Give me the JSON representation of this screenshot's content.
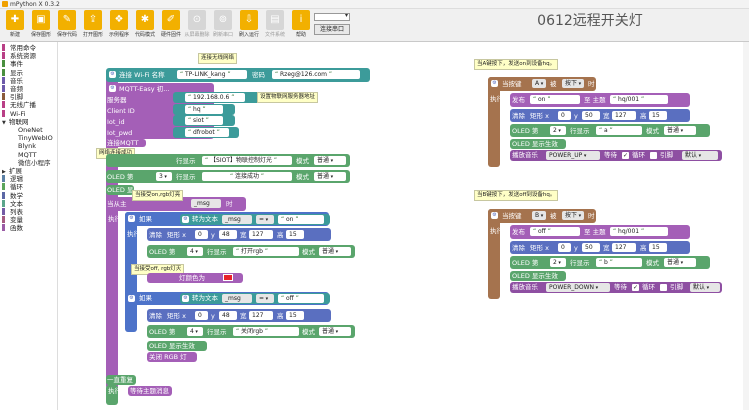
{
  "window": {
    "title": "mPython X 0.3.2"
  },
  "toolbar": {
    "buttons": [
      {
        "label": "新建",
        "icon": "new-file-icon"
      },
      {
        "label": "保存图形",
        "icon": "save-graphic-icon"
      },
      {
        "label": "保存代码",
        "icon": "save-code-icon"
      },
      {
        "label": "打开图形",
        "icon": "open-graphic-icon"
      },
      {
        "label": "示例程序",
        "icon": "example-icon"
      },
      {
        "label": "代码模式",
        "icon": "code-mode-icon"
      },
      {
        "label": "硬件固件",
        "icon": "firmware-icon"
      },
      {
        "label": "从屏幕删除",
        "icon": "disabled-icon"
      },
      {
        "label": "刷新串口",
        "icon": "refresh-icon"
      },
      {
        "label": "刷入运行",
        "icon": "flash-run-icon"
      },
      {
        "label": "文件系统",
        "icon": "file-system-icon"
      },
      {
        "label": "帮助",
        "icon": "help-icon"
      }
    ],
    "port_button": "连接串口"
  },
  "project_title": "0612远程开关灯",
  "sidebar": {
    "items": [
      {
        "label": "常用命令",
        "color": "#b93f86",
        "kind": "hdr"
      },
      {
        "label": "系统资源",
        "color": "#b93f86",
        "kind": "hdr"
      },
      {
        "label": "事件",
        "color": "#4a8f3f",
        "kind": "hdr"
      },
      {
        "label": "显示",
        "color": "#4a8f3f",
        "kind": "hdr"
      },
      {
        "label": "音乐",
        "color": "#6d5aaa",
        "kind": "hdr"
      },
      {
        "label": "音频",
        "color": "#6d5aaa",
        "kind": "hdr"
      },
      {
        "label": "引脚",
        "color": "#8a5a3a",
        "kind": "hdr"
      },
      {
        "label": "无线广播",
        "color": "#b93f86",
        "kind": "hdr"
      },
      {
        "label": "Wi-Fi",
        "color": "#b93f86",
        "kind": "hdr"
      },
      {
        "label": "物联网",
        "color": "",
        "kind": "tri"
      },
      {
        "label": "OneNet",
        "color": "",
        "kind": "sub"
      },
      {
        "label": "TinyWebIO",
        "color": "",
        "kind": "sub"
      },
      {
        "label": "Blynk",
        "color": "",
        "kind": "sub"
      },
      {
        "label": "MQTT",
        "color": "",
        "kind": "sub"
      },
      {
        "label": "微信小程序",
        "color": "",
        "kind": "sub"
      },
      {
        "label": "扩展",
        "color": "",
        "kind": "tri2"
      },
      {
        "label": "逻辑",
        "color": "#5b80a5",
        "kind": "hdr"
      },
      {
        "label": "循环",
        "color": "#5ba55b",
        "kind": "hdr"
      },
      {
        "label": "数学",
        "color": "#5b67a5",
        "kind": "hdr"
      },
      {
        "label": "文本",
        "color": "#5ba58c",
        "kind": "hdr"
      },
      {
        "label": "列表",
        "color": "#745ba5",
        "kind": "hdr"
      },
      {
        "label": "变量",
        "color": "#a55b80",
        "kind": "hdr"
      },
      {
        "label": "函数",
        "color": "#9a5ba5",
        "kind": "hdr"
      }
    ]
  },
  "blocks": {
    "wifi": {
      "label": "连接 Wi-Fi 名称",
      "ssid": "TP-LINK_kang",
      "pwd_label": "密码",
      "pwd": "Rzeg@126.com"
    },
    "mqtt": {
      "title": "MQTT-Easy 初...",
      "server_label": "服务器",
      "server": "192.168.0.6",
      "client_label": "Client ID",
      "client": "hq",
      "iotid_label": "Iot_id",
      "iotid": "siot",
      "iotpwd_label": "Iot_pwd",
      "iotpwd": "dfrobot"
    },
    "connect": "连接MQTT",
    "oled1": {
      "label": "OLED 第",
      "row": "1",
      "disp": "行显示",
      "text": "【SIOT】物联控制灯光",
      "mode_label": "模式",
      "mode": "普通"
    },
    "oled3": {
      "label": "OLED 第",
      "row": "3",
      "disp": "行显示",
      "text": "连接成功",
      "mode_label": "模式",
      "mode": "普通"
    },
    "oled_show": "OLED 显示生效",
    "recv": {
      "label": "当从主",
      "var": "_msg",
      "tail": "时",
      "exec": "执行"
    },
    "if1": {
      "if": "如果",
      "convert": "转为文本",
      "var": "_msg",
      "op": "=",
      "value": "on",
      "exec": "执行",
      "clear": "清除",
      "rect": "矩形 x",
      "x": "0",
      "y_label": "y",
      "y": "48",
      "w_label": "宽",
      "w": "127",
      "h_label": "高",
      "h": "15",
      "oled_label": "OLED 第",
      "row": "4",
      "disp": "行显示",
      "text": "打开rgb",
      "mode_label": "模式",
      "mode": "普通",
      "rgb": "灯颜色为"
    },
    "if2": {
      "if": "如果",
      "convert": "转为文本",
      "var": "_msg",
      "op": "=",
      "value": "off",
      "clear": "清除",
      "rect": "矩形 x",
      "x": "0",
      "y_label": "y",
      "y": "48",
      "w_label": "宽",
      "w": "127",
      "h_label": "高",
      "h": "15",
      "oled_label": "OLED 第",
      "row": "4",
      "disp": "行显示",
      "text": "关闭rgb",
      "mode_label": "模式",
      "mode": "普通",
      "show": "OLED 显示生效",
      "rgb_off": "关闭 RGB 灯"
    },
    "forever": {
      "label": "一直重复",
      "exec": "执行",
      "sub": "等待主题消息"
    },
    "btnA": {
      "when": "当按键",
      "key": "A",
      "pressed_label": "被",
      "pressed": "按下",
      "tail": "时",
      "exec": "执行",
      "publish": "发布",
      "msg": "on",
      "topic_label": "至 主题",
      "topic": "hq/001",
      "clear": "清除",
      "rect": "矩形 x",
      "x": "0",
      "y_label": "y",
      "y": "50",
      "w_label": "宽",
      "w": "127",
      "h_label": "高",
      "h": "15",
      "oled_label": "OLED 第",
      "row": "2",
      "disp": "行显示",
      "text": "a",
      "mode_label": "模式",
      "mode": "普通",
      "show": "OLED 显示生效",
      "music": "播放音乐",
      "tune": "POWER_UP",
      "wait": "等待",
      "loop": "循环",
      "pin_label": "引脚",
      "pin": "默认"
    },
    "btnB": {
      "when": "当按键",
      "key": "B",
      "pressed_label": "被",
      "pressed": "按下",
      "tail": "时",
      "exec": "执行",
      "publish": "发布",
      "msg": "off",
      "topic_label": "至 主题",
      "topic": "hq/001",
      "clear": "清除",
      "rect": "矩形 x",
      "x": "0",
      "y_label": "y",
      "y": "50",
      "w_label": "宽",
      "w": "127",
      "h_label": "高",
      "h": "15",
      "oled_label": "OLED 第",
      "row": "2",
      "disp": "行显示",
      "text": "b",
      "mode_label": "模式",
      "mode": "普通",
      "show": "OLED 显示生效",
      "music": "播放音乐",
      "tune": "POWER_DOWN",
      "wait": "等待",
      "loop": "循环",
      "pin_label": "引脚",
      "pin": "默认"
    }
  },
  "comments": {
    "wifi": "连接无线网络",
    "server": "设置物联网服务器地址",
    "connected": "网络连接成功",
    "on_cmd": "当接受on,rgb灯亮",
    "off_cmd": "当接受off, rgb灯灭",
    "btnA": "当A键按下，发送on到设备hq。",
    "btnB": "当B键按下，发送off到设备hq。"
  }
}
